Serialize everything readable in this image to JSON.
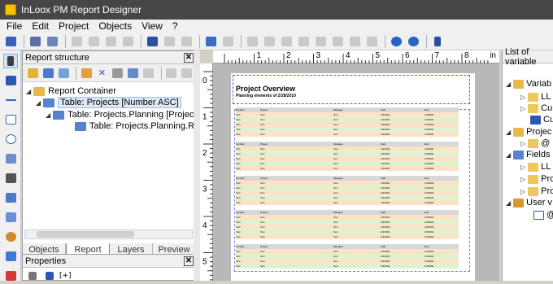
{
  "window": {
    "title": "InLoox PM Report Designer"
  },
  "menu": [
    "File",
    "Edit",
    "Project",
    "Objects",
    "View",
    "?"
  ],
  "report_structure": {
    "title": "Report structure",
    "tree": [
      {
        "label": "Report Container",
        "level": 0
      },
      {
        "label": "Table: Projects [Number ASC]",
        "level": 1,
        "selected": true
      },
      {
        "label": "Table: Projects.Planning [Project2R",
        "level": 2
      },
      {
        "label": "Table: Projects.Planning.Resour",
        "level": 3
      }
    ],
    "tabs": [
      "Objects",
      "Report st...",
      "Layers",
      "Preview"
    ],
    "active_tab": 1
  },
  "properties": {
    "title": "Properties",
    "sort_label": "[+]"
  },
  "ruler": {
    "unit": "in",
    "h_numbers": [
      "1",
      "2",
      "3",
      "4",
      "5",
      "6",
      "7",
      "8"
    ],
    "v_numbers": [
      "0",
      "1",
      "2",
      "3",
      "4",
      "5"
    ]
  },
  "report": {
    "title": "Project Overview",
    "subtitle": "Planning elements of 2/28/2010",
    "header_cells": [
      "Number",
      "Project",
      "Manager",
      "Start",
      "End"
    ],
    "row_cells": [
      "Text",
      "Text",
      "Text",
      "1/3/2001",
      "1/3/2001"
    ]
  },
  "variables": {
    "title": "List of variable",
    "items": [
      {
        "label": "Variab",
        "level": 0
      },
      {
        "label": "LL",
        "level": 1
      },
      {
        "label": "Cu",
        "level": 1
      },
      {
        "label": "Cu",
        "level": 1
      },
      {
        "label": "Projec",
        "level": 0
      },
      {
        "label": "@",
        "level": 1
      },
      {
        "label": "Fields",
        "level": 0
      },
      {
        "label": "LL",
        "level": 1
      },
      {
        "label": "Pro",
        "level": 1
      },
      {
        "label": "Pro",
        "level": 1
      },
      {
        "label": "User v",
        "level": 0
      },
      {
        "label": "@",
        "level": 1
      }
    ]
  }
}
